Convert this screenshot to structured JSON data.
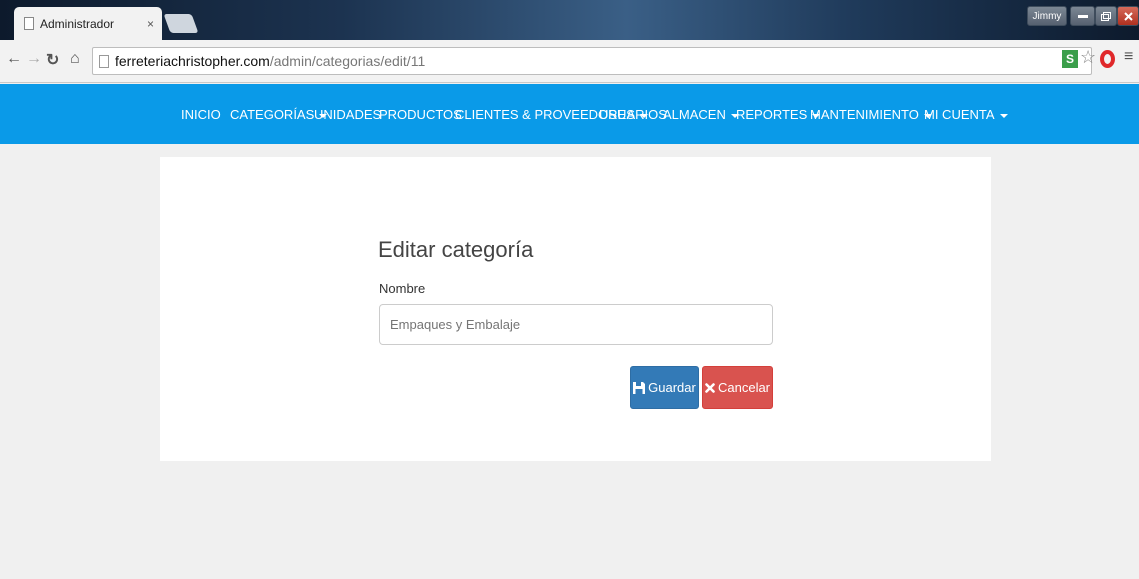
{
  "browser": {
    "tab_title": "Administrador",
    "tab_close": "×",
    "user_label": "Jimmy",
    "url_host": "ferreteriachristopher.com",
    "url_path": "/admin/categorias/edit/11",
    "ext_label": "S"
  },
  "navbar": {
    "items": [
      {
        "label": "INICIO",
        "dropdown": false
      },
      {
        "label": "CATEGORÍAS",
        "dropdown": true
      },
      {
        "label": "UNIDADES",
        "dropdown": false
      },
      {
        "label": "PRODUCTOS",
        "dropdown": false
      },
      {
        "label": "CLIENTES & PROVEEDORES",
        "dropdown": true
      },
      {
        "label": "USUARIOS",
        "dropdown": false
      },
      {
        "label": "ALMACEN",
        "dropdown": true
      },
      {
        "label": "REPORTES",
        "dropdown": true
      },
      {
        "label": "MANTENIMIENTO",
        "dropdown": true
      },
      {
        "label": "MI CUENTA",
        "dropdown": true
      }
    ]
  },
  "form": {
    "title": "Editar categoría",
    "name_label": "Nombre",
    "name_placeholder": "Empaques y Embalaje",
    "save_label": "Guardar",
    "cancel_label": "Cancelar"
  },
  "colors": {
    "navbar": "#0a9ae8",
    "save_button": "#337ab7",
    "cancel_button": "#d9534f"
  },
  "icons": {
    "save": "floppy-disk-icon",
    "cancel": "x-icon"
  }
}
